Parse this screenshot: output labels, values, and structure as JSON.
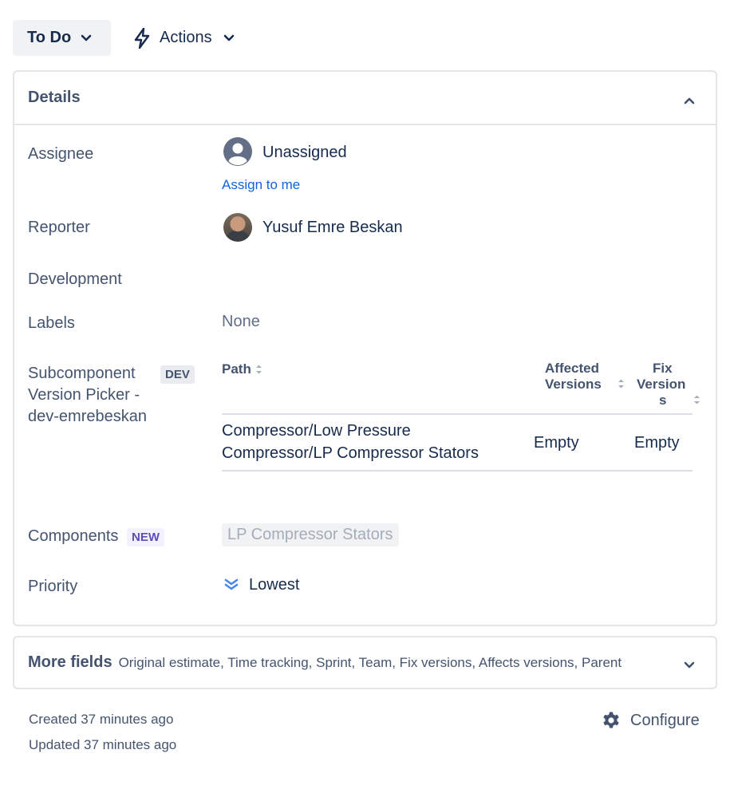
{
  "toolbar": {
    "status_label": "To Do",
    "actions_label": "Actions"
  },
  "details": {
    "title": "Details",
    "assignee": {
      "label": "Assignee",
      "value": "Unassigned",
      "assign_link": "Assign to me"
    },
    "reporter": {
      "label": "Reporter",
      "value": "Yusuf Emre Beskan"
    },
    "development": {
      "label": "Development"
    },
    "labels": {
      "label": "Labels",
      "value": "None"
    },
    "subcomponent": {
      "label_line1": "Subcomponent",
      "label_line2": "Version Picker -",
      "label_line3": "dev-emrebeskan",
      "badge": "DEV",
      "columns": {
        "path": "Path",
        "affected_line1": "Affected",
        "affected_line2": "Versions",
        "fix_line1": "Fix",
        "fix_line2": "Version",
        "fix_line3": "s"
      },
      "rows": [
        {
          "path_line1": "Compressor/Low Pressure",
          "path_line2": "Compressor/LP Compressor Stators",
          "affected": "Empty",
          "fix": "Empty"
        }
      ]
    },
    "components": {
      "label": "Components",
      "badge": "NEW",
      "value": "LP Compressor Stators"
    },
    "priority": {
      "label": "Priority",
      "value": "Lowest",
      "icon": "priority-lowest-icon",
      "color": "#4688ec"
    }
  },
  "more_fields": {
    "title": "More fields",
    "list": "Original estimate, Time tracking, Sprint, Team, Fix versions, Affects versions, Parent"
  },
  "footer": {
    "created": "Created 37 minutes ago",
    "updated": "Updated 37 minutes ago",
    "configure_label": "Configure"
  },
  "colors": {
    "link": "#0c66e4",
    "text": "#172b4d",
    "subtle_text": "#44546f",
    "border": "#e3e5e9"
  }
}
